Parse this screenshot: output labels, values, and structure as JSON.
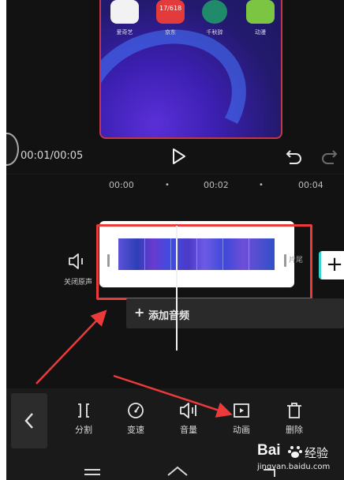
{
  "preview": {
    "apps": [
      {
        "label": "爱奇艺",
        "badge": "",
        "color": "#f2f2f2"
      },
      {
        "label": "京东",
        "badge": "17/618",
        "color": "#e33b3b"
      },
      {
        "label": "千秋辞",
        "badge": "",
        "color": "#1f8b6a"
      },
      {
        "label": "动漫",
        "badge": "",
        "color": "#7cc542"
      }
    ]
  },
  "player": {
    "time": "00:01/00:05",
    "play_icon": "play-icon",
    "undo_icon": "undo-icon",
    "redo_icon": "redo-icon"
  },
  "ruler": {
    "ticks": [
      "00:00",
      "00:02",
      "00:04"
    ]
  },
  "track": {
    "mute_label": "关闭原声",
    "end_tag": "片尾",
    "add_track_label": "+",
    "add_audio_label": "添加音频"
  },
  "toolbar": {
    "back_icon": "chevron-left-icon",
    "items": [
      {
        "label": "分割",
        "icon": "split-icon"
      },
      {
        "label": "变速",
        "icon": "speed-icon"
      },
      {
        "label": "音量",
        "icon": "volume-icon"
      },
      {
        "label": "动画",
        "icon": "animation-icon"
      },
      {
        "label": "删除",
        "icon": "delete-icon"
      }
    ]
  },
  "watermark": {
    "brand": "Bai",
    "brand2": "经验",
    "url": "jingyan.baidu.com"
  },
  "colors": {
    "annotation": "#ec3a3a",
    "accent_teal": "#36d6d0",
    "background": "#121212"
  }
}
